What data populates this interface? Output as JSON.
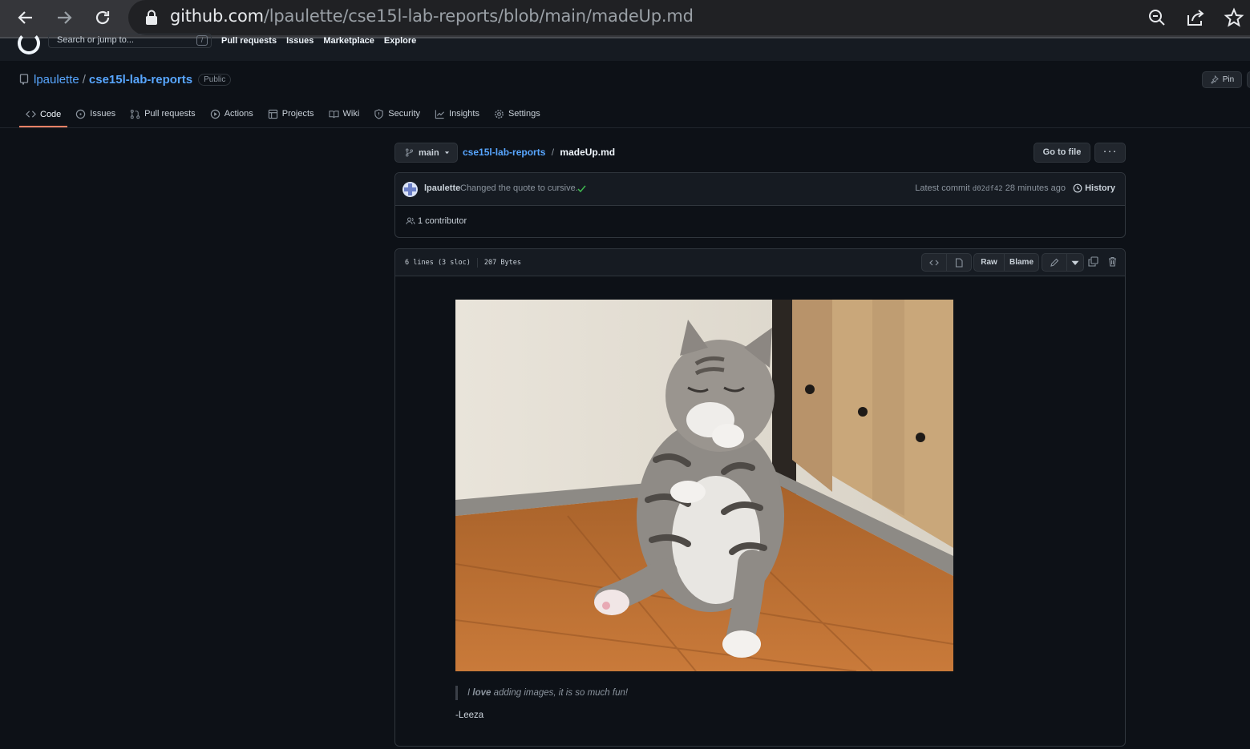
{
  "browser": {
    "url_host": "github.com",
    "url_path": "/lpaulette/cse15l-lab-reports/blob/main/madeUp.md"
  },
  "gh_header": {
    "search_placeholder": "Search or jump to...",
    "search_shortcut": "/",
    "nav": [
      "Pull requests",
      "Issues",
      "Marketplace",
      "Explore"
    ]
  },
  "repo": {
    "owner": "lpaulette",
    "separator": "/",
    "name": "cse15l-lab-reports",
    "visibility": "Public",
    "pin_label": "Pin"
  },
  "tabs": [
    {
      "label": "Code",
      "icon": "code-icon",
      "active": true
    },
    {
      "label": "Issues",
      "icon": "issue-icon"
    },
    {
      "label": "Pull requests",
      "icon": "pull-request-icon"
    },
    {
      "label": "Actions",
      "icon": "play-icon"
    },
    {
      "label": "Projects",
      "icon": "table-icon"
    },
    {
      "label": "Wiki",
      "icon": "book-icon"
    },
    {
      "label": "Security",
      "icon": "shield-icon"
    },
    {
      "label": "Insights",
      "icon": "graph-icon"
    },
    {
      "label": "Settings",
      "icon": "gear-icon"
    }
  ],
  "file_nav": {
    "branch": "main",
    "crumb_repo": "cse15l-lab-reports",
    "crumb_sep": "/",
    "crumb_file": "madeUp.md",
    "go_to_file": "Go to file",
    "more": "···"
  },
  "commit": {
    "author": "lpaulette",
    "message": "Changed the quote to cursive.",
    "latest_label": "Latest commit",
    "sha": "d02df42",
    "time": "28 minutes ago",
    "history_label": "History",
    "contributors": "1 contributor"
  },
  "file": {
    "lines": "6 lines (3 sloc)",
    "size": "207 Bytes",
    "raw_label": "Raw",
    "blame_label": "Blame"
  },
  "markdown": {
    "quote_pre": "I ",
    "quote_bold": "love",
    "quote_post": " adding images, it is so much fun!",
    "signature": "-Leeza"
  },
  "colors": {
    "accent_link": "#58a6ff",
    "active_tab_underline": "#f78166",
    "check": "#3fb950"
  }
}
